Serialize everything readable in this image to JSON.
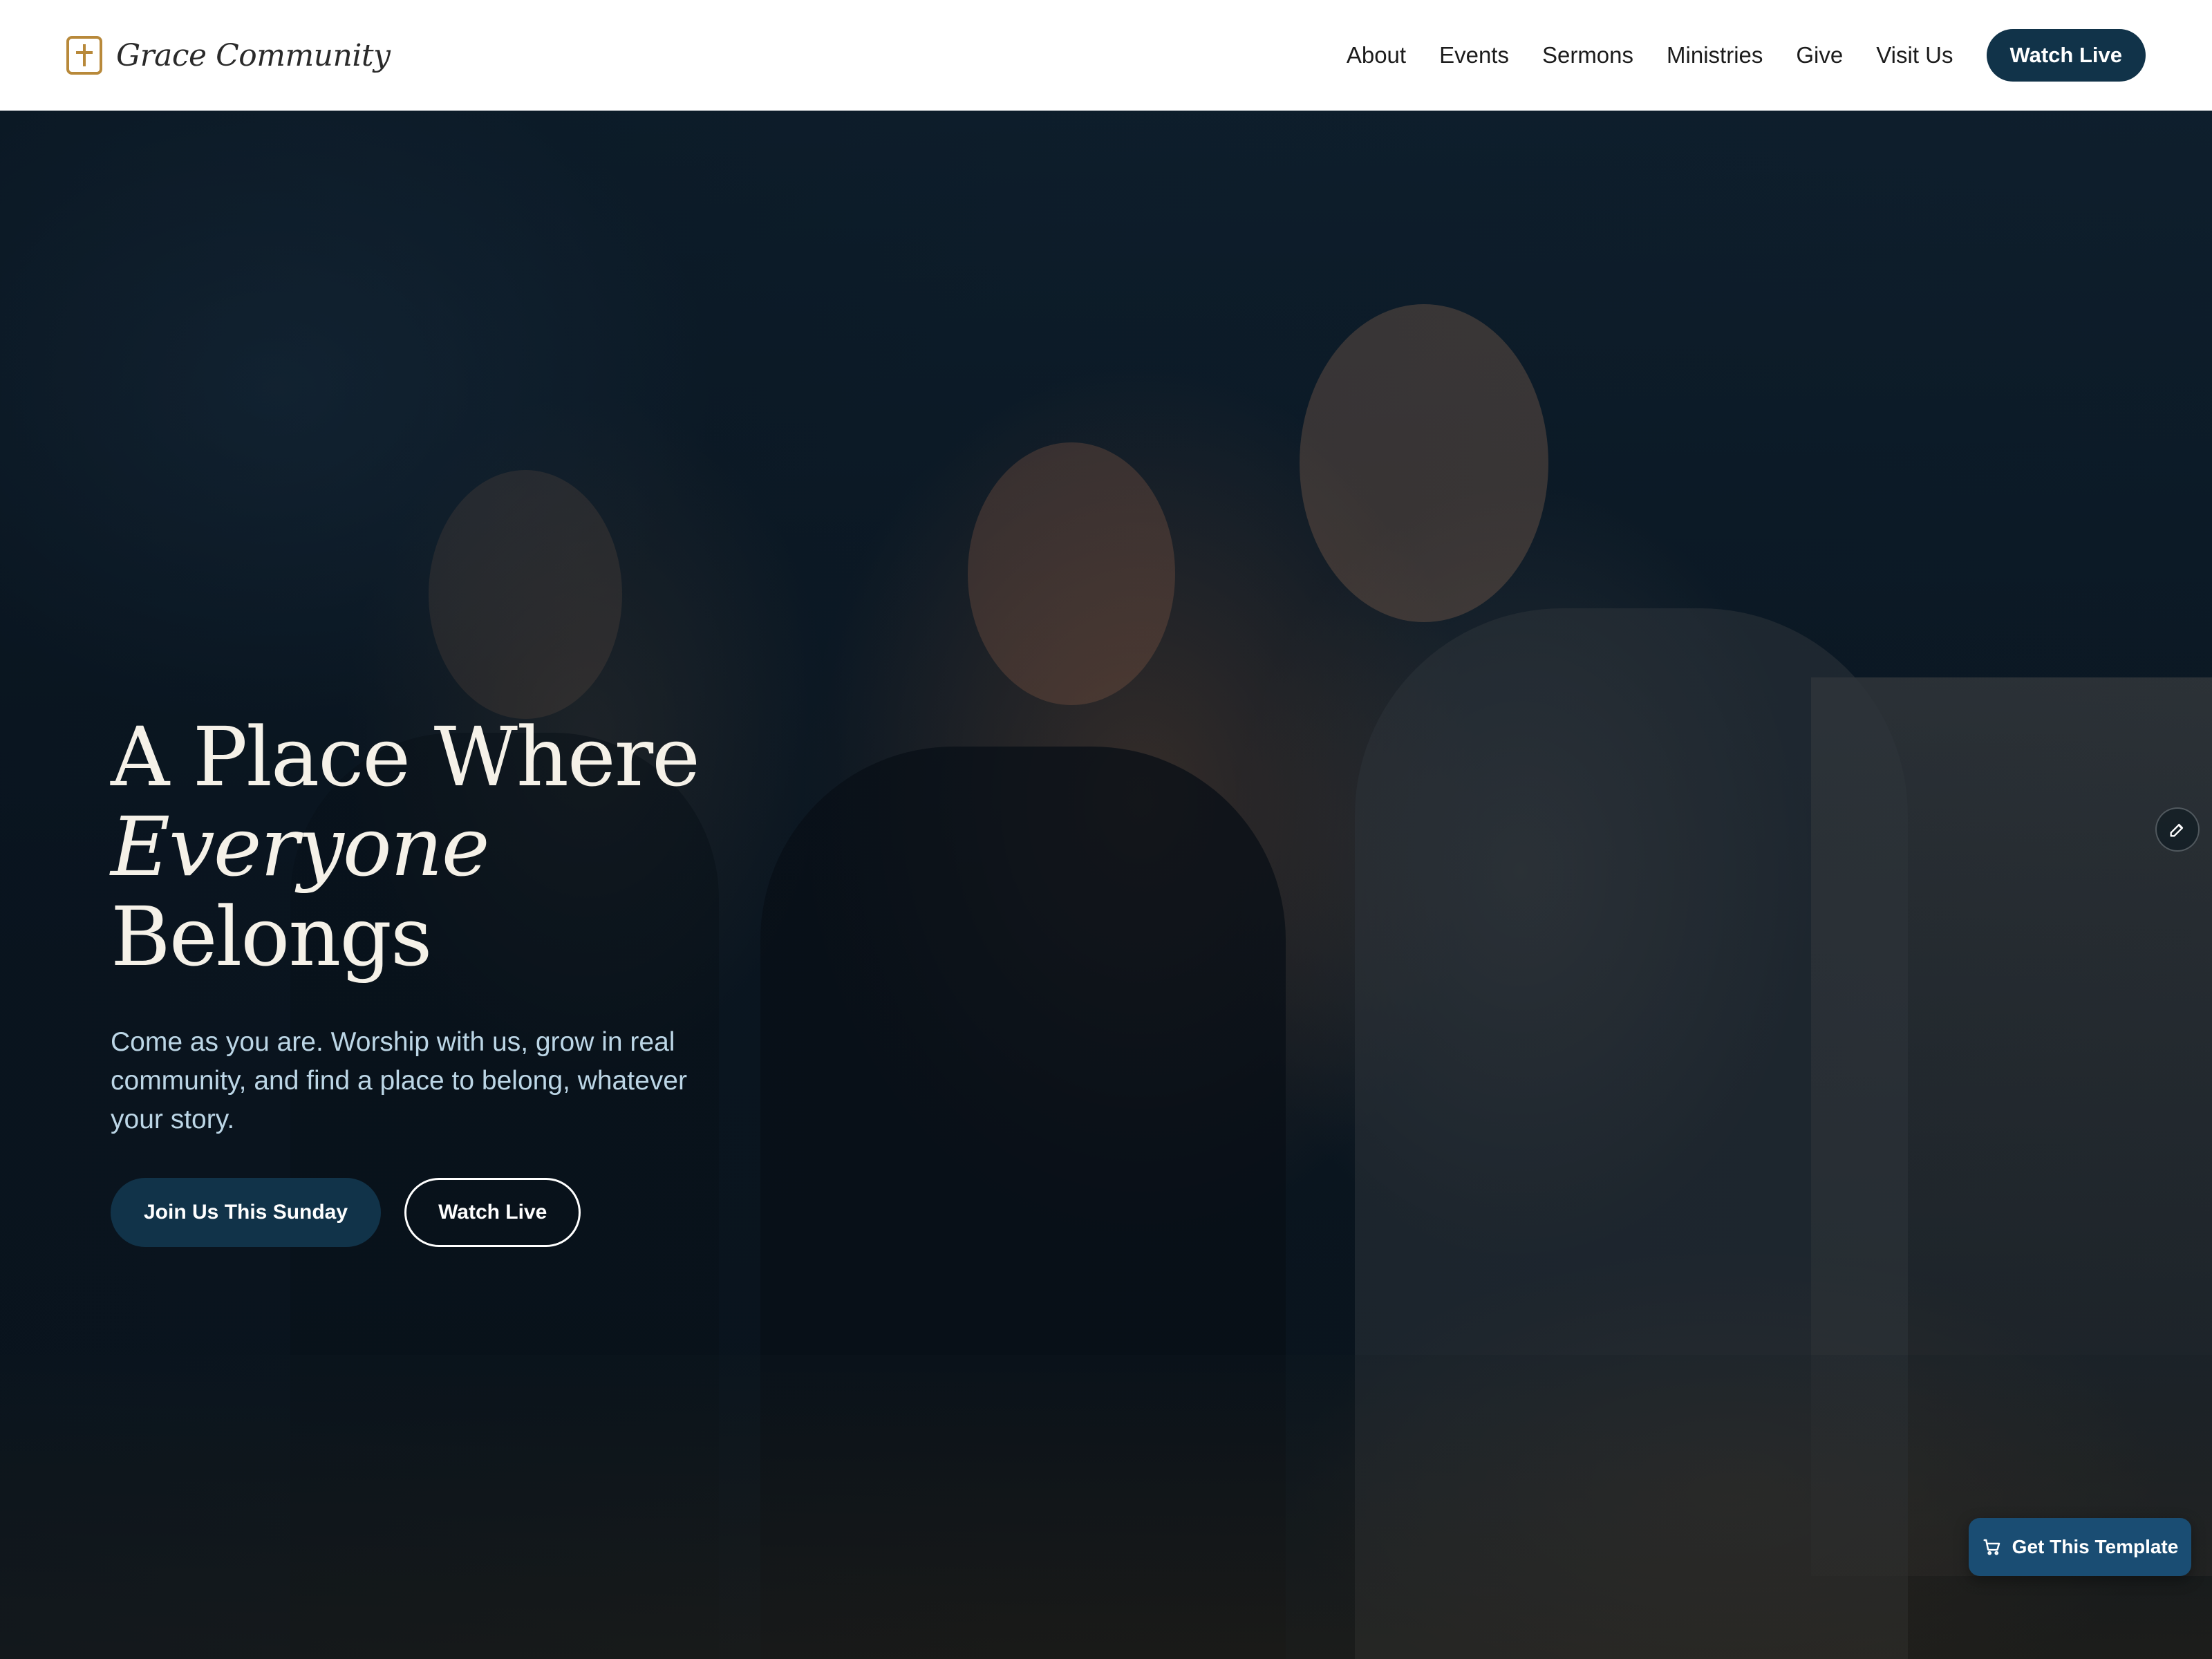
{
  "brand": {
    "name": "Grace Community",
    "icon": "cross-icon",
    "accent_color": "#b8893a"
  },
  "nav": {
    "links": [
      "About",
      "Events",
      "Sermons",
      "Ministries",
      "Give",
      "Visit Us"
    ],
    "cta_label": "Watch Live"
  },
  "hero": {
    "title_prefix": "A Place Where ",
    "title_emphasis": "Everyone",
    "title_suffix": "Belongs",
    "subtitle": "Come as you are. Worship with us, grow in real community, and find a place to belong, whatever your story.",
    "primary_button": "Join Us This Sunday",
    "secondary_button": "Watch Live"
  },
  "floating": {
    "edit_icon": "pencil-icon",
    "template_button": "Get This Template",
    "template_icon": "cart-icon"
  },
  "colors": {
    "primary": "#113349",
    "template_button": "#1a4d73",
    "subtitle": "#bcd6e6",
    "title": "#f5f1e8"
  }
}
